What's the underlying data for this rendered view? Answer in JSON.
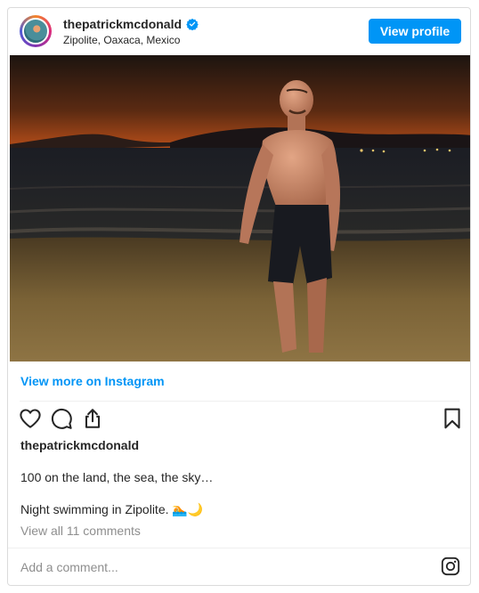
{
  "header": {
    "username": "thepatrickmcdonald",
    "location": "Zipolite, Oaxaca, Mexico",
    "view_profile_label": "View profile"
  },
  "post": {
    "view_more_label": "View more on Instagram",
    "poster_username": "thepatrickmcdonald",
    "caption_line1": "100 on the land, the sea, the sky…",
    "caption_line2": "Night swimming in Zipolite. 🏊🌙",
    "view_comments_label": "View all 11 comments"
  },
  "comment_box": {
    "placeholder": "Add a comment..."
  },
  "icons": [
    "heart-icon",
    "comment-icon",
    "share-icon",
    "bookmark-icon",
    "instagram-icon",
    "verified-badge-icon"
  ],
  "colors": {
    "accent": "#0095f6",
    "text": "#262626",
    "muted": "#8e8e8e",
    "border": "#dbdbdb"
  }
}
